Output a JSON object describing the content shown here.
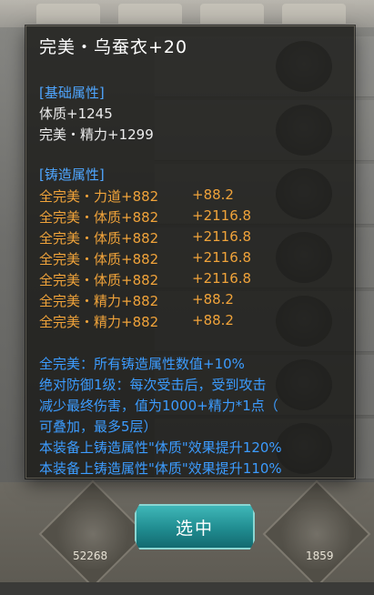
{
  "item": {
    "title": "完美・乌蚕衣+20"
  },
  "basic": {
    "header": "[基础属性]",
    "lines": [
      "体质+1245",
      "完美・精力+1299"
    ]
  },
  "forge": {
    "header": "[铸造属性]",
    "lines": [
      {
        "attr": "全完美・力道+882",
        "bonus": "+88.2"
      },
      {
        "attr": "全完美・体质+882",
        "bonus": "+2116.8"
      },
      {
        "attr": "全完美・体质+882",
        "bonus": "+2116.8"
      },
      {
        "attr": "全完美・体质+882",
        "bonus": "+2116.8"
      },
      {
        "attr": "全完美・体质+882",
        "bonus": "+2116.8"
      },
      {
        "attr": "全完美・精力+882",
        "bonus": "+88.2"
      },
      {
        "attr": "全完美・精力+882",
        "bonus": "+88.2"
      }
    ]
  },
  "effects": [
    "全完美：所有铸造属性数值+10%",
    "绝对防御1级：每次受击后，受到攻击",
    "减少最终伤害，值为1000+精力*1点（",
    "可叠加，最多5层）",
    "本装备上铸造属性\"体质\"效果提升120%",
    "本装备上铸造属性\"体质\"效果提升110%"
  ],
  "button": {
    "select_label": "选中"
  },
  "background": {
    "slot_left_count": "52268",
    "slot_right_count": "1859"
  },
  "colors": {
    "title": "#ffffff",
    "section": "#4fa6ff",
    "forge": "#f0a33a",
    "effect": "#3c9cff",
    "button": "#208c90"
  }
}
